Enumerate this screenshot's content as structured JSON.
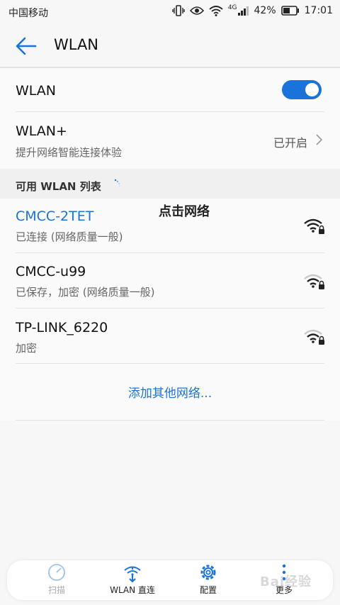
{
  "status": {
    "carrier": "中国移动",
    "network": "4G",
    "battery": "42%",
    "time": "17:01"
  },
  "appbar": {
    "title": "WLAN"
  },
  "wlan_toggle": {
    "label": "WLAN",
    "on": true
  },
  "wlan_plus": {
    "label": "WLAN+",
    "subtitle": "提升网络智能连接体验",
    "state": "已开启"
  },
  "list_header": "可用 WLAN 列表",
  "annotation": "点击网络",
  "networks": [
    {
      "name": "CMCC-2TET",
      "status": "已连接 (网络质量一般)",
      "connected": true
    },
    {
      "name": "CMCC-u99",
      "status": "已保存，加密 (网络质量一般)",
      "connected": false
    },
    {
      "name": "TP-LINK_6220",
      "status": "加密",
      "connected": false
    }
  ],
  "add_network": "添加其他网络...",
  "bottom_nav": [
    {
      "label": "扫描",
      "icon": "scan-icon",
      "disabled": true
    },
    {
      "label": "WLAN 直连",
      "icon": "wifi-direct-icon",
      "disabled": false
    },
    {
      "label": "配置",
      "icon": "gear-icon",
      "disabled": false
    },
    {
      "label": "更多",
      "icon": "more-icon",
      "disabled": false
    }
  ],
  "watermark": "Bai经验",
  "colors": {
    "accent": "#1a73d8",
    "connected_text": "#1a73d8"
  }
}
